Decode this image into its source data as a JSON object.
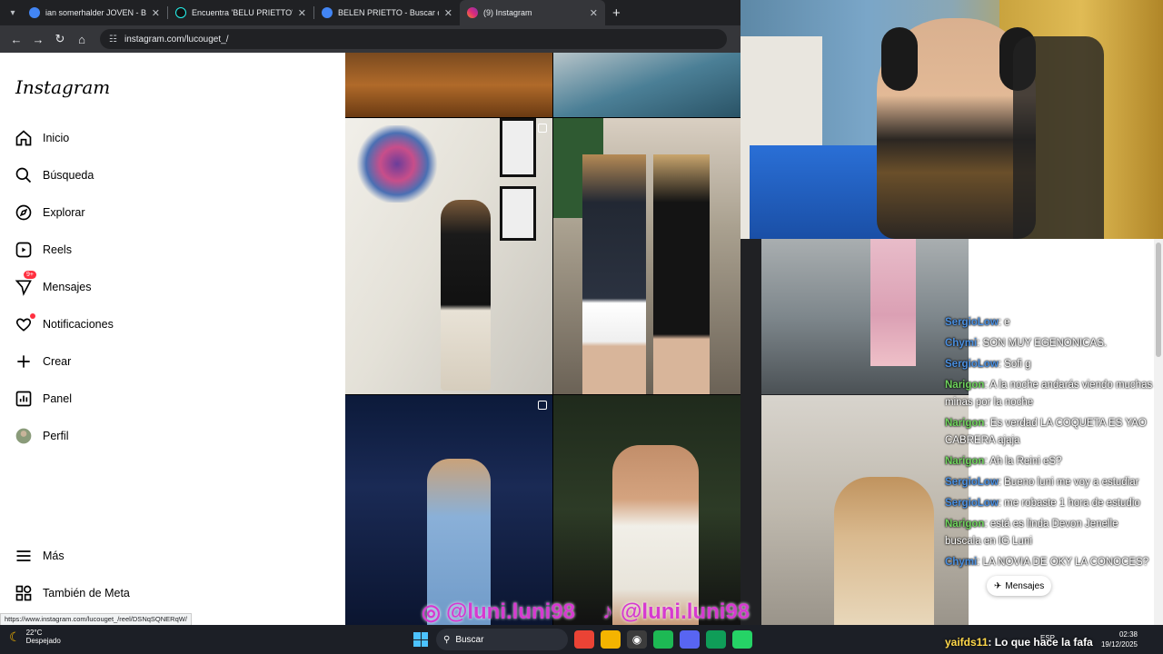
{
  "browser": {
    "tabs": [
      {
        "label": "ian somerhalder JOVEN - Busca",
        "active": false
      },
      {
        "label": "Encuentra 'BELU PRIETTO' en Ti",
        "active": false
      },
      {
        "label": "BELEN PRIETTO - Buscar con Go",
        "active": false
      },
      {
        "label": "(9) Instagram",
        "active": true
      }
    ],
    "url": "instagram.com/lucouget_/"
  },
  "instagram": {
    "logo": "Instagram",
    "nav": [
      {
        "label": "Inicio",
        "icon": "home-icon"
      },
      {
        "label": "Búsqueda",
        "icon": "search-icon"
      },
      {
        "label": "Explorar",
        "icon": "compass-icon"
      },
      {
        "label": "Reels",
        "icon": "reels-icon"
      },
      {
        "label": "Mensajes",
        "icon": "messenger-icon",
        "badge": "9+"
      },
      {
        "label": "Notificaciones",
        "icon": "heart-icon"
      },
      {
        "label": "Crear",
        "icon": "plus-icon"
      },
      {
        "label": "Panel",
        "icon": "chart-icon"
      },
      {
        "label": "Perfil",
        "icon": "avatar-icon"
      }
    ],
    "more": [
      {
        "label": "Más",
        "icon": "menu-icon"
      },
      {
        "label": "También de Meta",
        "icon": "meta-icon"
      }
    ],
    "messages_float": "Mensajes"
  },
  "status_url": "https://www.instagram.com/lucouget_/reel/DSNqSQNERqW/",
  "chat": [
    {
      "user": "SergioLow",
      "text": ": e",
      "color": "#4a8fe0"
    },
    {
      "user": "Chymi",
      "text": ": SON MUY EGENONICAS.",
      "color": "#4a8fe0"
    },
    {
      "user": "SergioLow",
      "text": ": Sofi g",
      "color": "#4a8fe0"
    },
    {
      "user": "Narigon",
      "text": ": A la noche andarás viendo muchas minas por la noche",
      "color": "#6fd35d"
    },
    {
      "user": "Narigon",
      "text": ": Es verdad LA COQUETA ES YAO CABRERA ajaja",
      "color": "#6fd35d"
    },
    {
      "user": "Narigon",
      "text": ": Ah la Reini eS?",
      "color": "#6fd35d"
    },
    {
      "user": "SergioLow",
      "text": ": Bueno luni me voy a estudiar",
      "color": "#4a8fe0"
    },
    {
      "user": "SergioLow",
      "text": ": me robaste 1 hora de estudio",
      "color": "#4a8fe0"
    },
    {
      "user": "Narigon",
      "text": ": está es linda Devon Jenelle buscala en IG Luni",
      "color": "#6fd35d"
    },
    {
      "user": "Chymi",
      "text": ": LA NOVIA DE OKY LA CONOCES?",
      "color": "#4a8fe0"
    }
  ],
  "stream_handle": "@luni.luni98",
  "ticker": {
    "user": "yaifds11",
    "text": ": Lo que hace la fafa"
  },
  "taskbar": {
    "temp": "22°C",
    "weather": "Despejado",
    "search": "Buscar",
    "lang": "ESP",
    "time": "02:38",
    "date": "19/12/2025"
  }
}
